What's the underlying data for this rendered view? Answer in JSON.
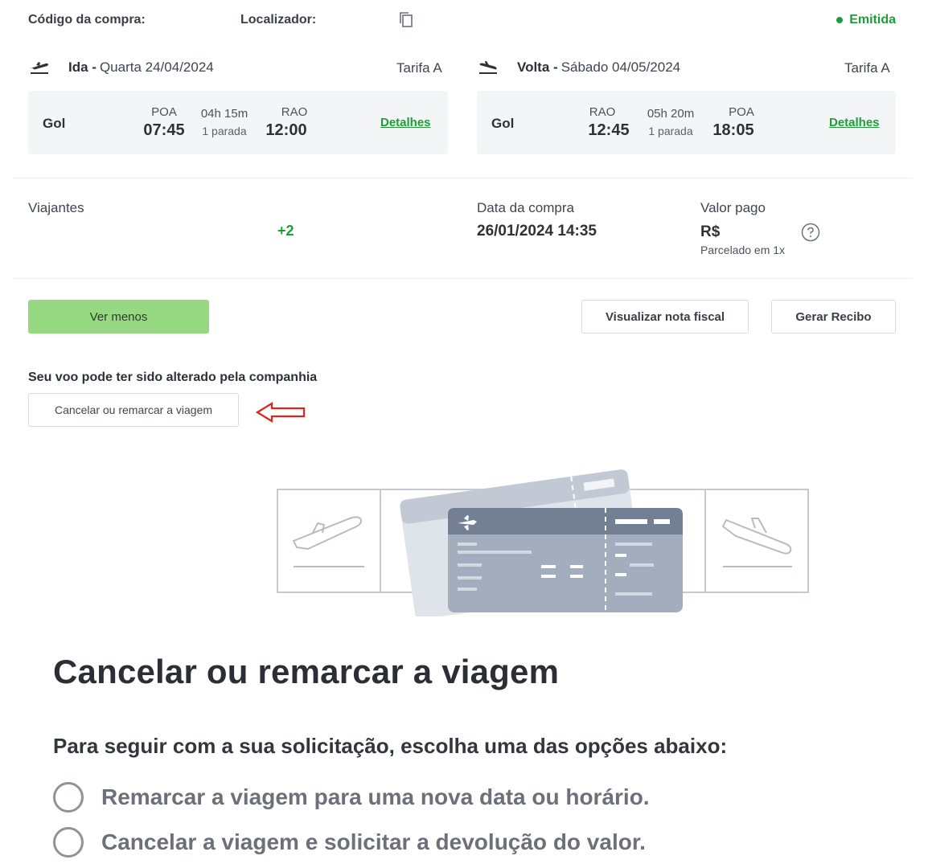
{
  "header": {
    "codigo_label": "Código da compra:",
    "localizador_label": "Localizador:",
    "status_text": "Emitida"
  },
  "outbound": {
    "direction": "Ida -",
    "date": "Quarta 24/04/2024",
    "tarifa": "Tarifa A",
    "airline": "Gol",
    "origin_code": "POA",
    "origin_time": "07:45",
    "duration": "04h 15m",
    "stops": "1 parada",
    "dest_code": "RAO",
    "dest_time": "12:00",
    "details_label": "Detalhes"
  },
  "return": {
    "direction": "Volta -",
    "date": "Sábado 04/05/2024",
    "tarifa": "Tarifa A",
    "airline": "Gol",
    "origin_code": "RAO",
    "origin_time": "12:45",
    "duration": "05h 20m",
    "stops": "1 parada",
    "dest_code": "POA",
    "dest_time": "18:05",
    "details_label": "Detalhes"
  },
  "info": {
    "viajantes_label": "Viajantes",
    "viajantes_extra": "+2",
    "data_compra_label": "Data da compra",
    "data_compra_value": "26/01/2024 14:35",
    "valor_pago_label": "Valor pago",
    "valor_pago_value": "R$",
    "parcelado": "Parcelado em 1x"
  },
  "actions": {
    "ver_menos": "Ver menos",
    "visualizar_nota": "Visualizar nota fiscal",
    "gerar_recibo": "Gerar Recibo"
  },
  "notice": {
    "text": "Seu voo pode ter sido alterado pela companhia",
    "button": "Cancelar ou remarcar a viagem"
  },
  "modal": {
    "title": "Cancelar ou remarcar a viagem",
    "instruction": "Para seguir com a sua solicitação, escolha uma das opções abaixo:",
    "options": [
      "Remarcar a viagem para uma nova data ou horário.",
      "Cancelar a viagem e solicitar a devolução do valor."
    ]
  },
  "colors": {
    "accent_green": "#1f9d3a",
    "button_green": "#96d982",
    "annotation_red": "#e0241b"
  },
  "icons": [
    "copy-icon",
    "takeoff-icon",
    "landing-icon",
    "help-icon",
    "annotation-arrow-icon",
    "tickets-illustration"
  ]
}
